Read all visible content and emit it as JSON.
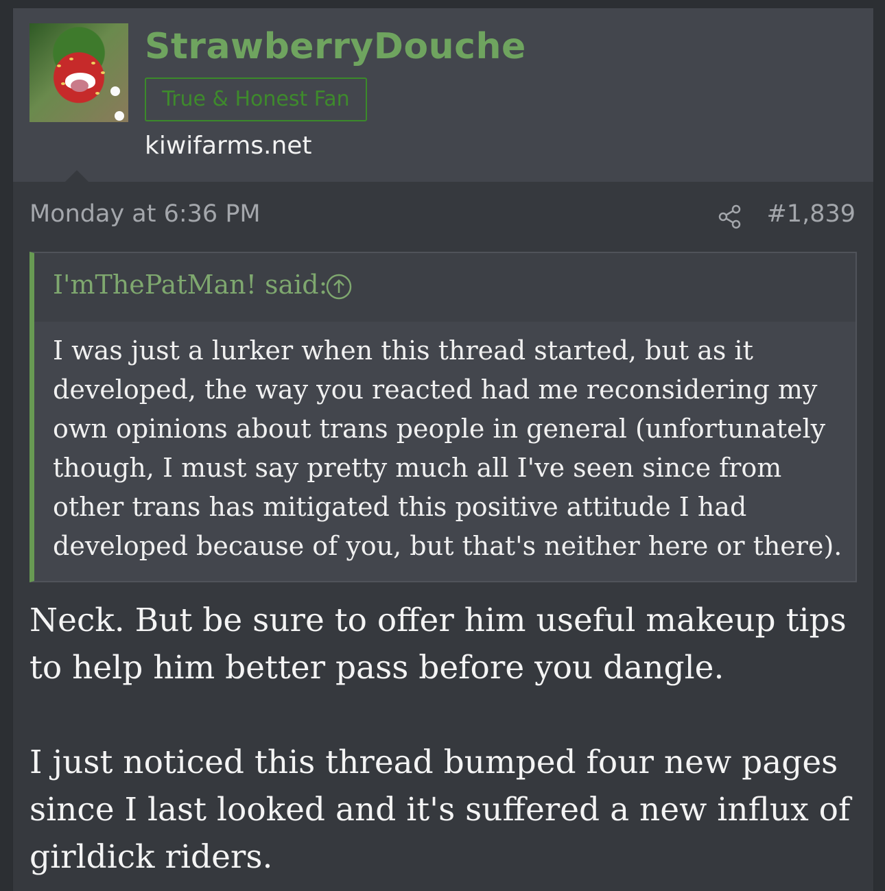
{
  "user": {
    "username": "StrawberryDouche",
    "title": "True & Honest Fan",
    "extra": "kiwifarms.net"
  },
  "post": {
    "date": "Monday at 6:36 PM",
    "number": "#1,839",
    "share_icon": "share-icon"
  },
  "quote": {
    "author": "I'mThePatMan! said:",
    "jump_icon": "arrow-up-circle-icon",
    "text": "I was just a lurker when this thread started, but as it developed, the way you reacted had me reconsidering my own opinions about trans people in general (unfortunately though, I must say pretty much all I've seen since from other trans has mitigated this positive attitude I had developed because of you, but that's neither here or there)."
  },
  "message": {
    "paragraphs": [
      "Neck. But be sure to offer him useful makeup tips to help him better pass before you dangle.",
      "I just noticed this thread bumped four new pages since I last looked and it's suffered a new influx of girldick riders."
    ]
  },
  "colors": {
    "username": "#6fa45f",
    "title_border": "#3b8a2a",
    "quote_accent": "#689a53",
    "header_bg": "#43464d",
    "post_bg": "#36393e"
  }
}
